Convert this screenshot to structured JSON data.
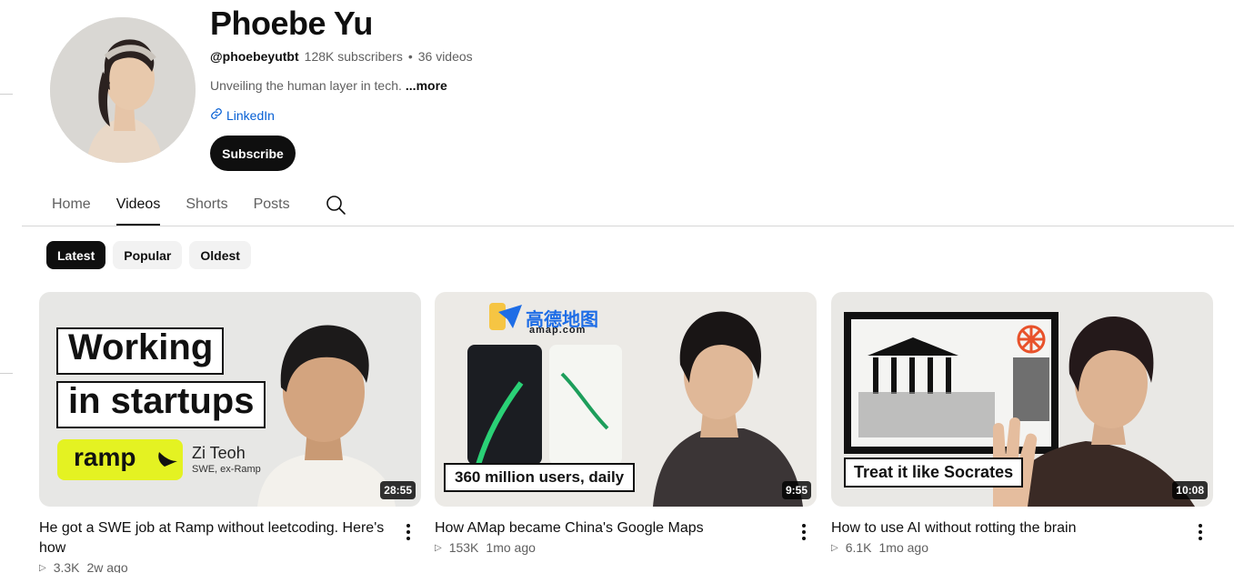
{
  "channel": {
    "name": "Phoebe Yu",
    "handle": "@phoebeyutbt",
    "subscribers": "128K subscribers",
    "separator": "•",
    "video_count": "36 videos",
    "description": "Unveiling the human layer in tech.",
    "more_label": "...more",
    "link_label": "LinkedIn",
    "subscribe_label": "Subscribe"
  },
  "tabs": [
    {
      "label": "Home"
    },
    {
      "label": "Videos",
      "active": true
    },
    {
      "label": "Shorts"
    },
    {
      "label": "Posts"
    }
  ],
  "chips": [
    {
      "label": "Latest",
      "active": true
    },
    {
      "label": "Popular"
    },
    {
      "label": "Oldest"
    }
  ],
  "videos": [
    {
      "title": "He got a SWE job at Ramp without leetcoding. Here's how",
      "views": "3.3K",
      "age": "2w ago",
      "duration": "28:55",
      "thumb": {
        "line1": "Working",
        "line2": "in startups",
        "brand": "ramp",
        "person_name": "Zi Teoh",
        "person_role": "SWE, ex-Ramp"
      }
    },
    {
      "title": "How AMap became China's Google Maps",
      "views": "153K",
      "age": "1mo ago",
      "duration": "9:55",
      "thumb": {
        "logo_cn": "高德地图",
        "logo_url": "amap.com",
        "caption": "360 million users, daily"
      }
    },
    {
      "title": "How to use AI without rotting the brain",
      "views": "6.1K",
      "age": "1mo ago",
      "duration": "10:08",
      "thumb": {
        "caption": "Treat it like Socrates"
      }
    }
  ],
  "colors": {
    "accent_link": "#065fd4",
    "ramp_yellow": "#e4f222",
    "text_primary": "#0f0f0f",
    "text_secondary": "#606060"
  }
}
